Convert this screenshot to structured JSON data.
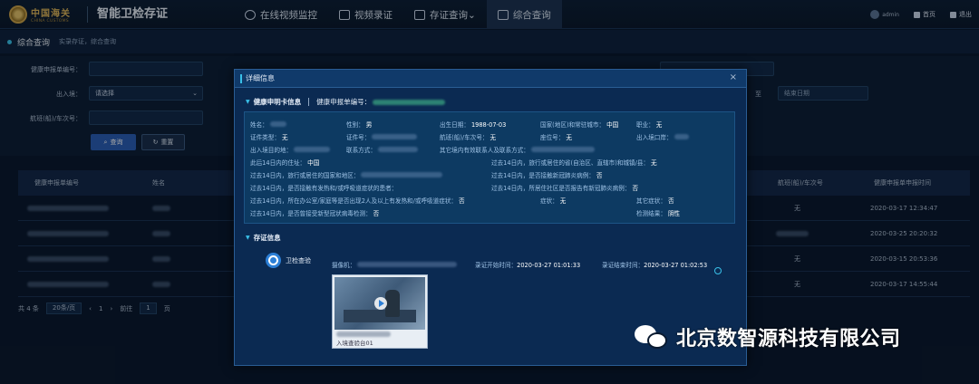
{
  "topbar": {
    "logo_cn": "中国海关",
    "logo_en": "CHINA CUSTOMS",
    "app_title": "智能卫检存证",
    "nav": [
      {
        "label": "在线视频监控",
        "icon": "monitor-icon"
      },
      {
        "label": "视频录证",
        "icon": "video-record-icon"
      },
      {
        "label": "存证查询⌄",
        "icon": "evidence-query-icon"
      },
      {
        "label": "综合查询",
        "icon": "layers-icon"
      }
    ],
    "user": "admin",
    "home": "首页",
    "logout": "退出"
  },
  "breadcrumb": {
    "title": "综合查询",
    "subtitle": "实录存证，综合查询"
  },
  "filters": {
    "label_health_no": "健康申报单编号：",
    "label_entry_exit": "出入境：",
    "entry_exit_value": "请选择",
    "label_flight": "航班(船)/车次号：",
    "label_end_date": "至",
    "end_date_placeholder": "结束日期",
    "query_button": "查询",
    "reset_button": "重置"
  },
  "table": {
    "col_health_no": "健康申报单编号",
    "col_name": "姓名",
    "col_flight": "航班(船)/车次号",
    "col_time": "健康申报单申报时间",
    "rows": [
      {
        "flight": "无",
        "time": "2020-03-17 12:34:47"
      },
      {
        "flight": "",
        "time": "2020-03-25 20:20:32"
      },
      {
        "flight": "无",
        "time": "2020-03-15 20:53:36"
      },
      {
        "flight": "无",
        "time": "2020-03-17 14:55:44"
      }
    ]
  },
  "pager": {
    "total": "共 4 条",
    "page_size": "20条/页",
    "current": "1",
    "goto_label": "前往",
    "goto_value": "1",
    "goto_unit": "页"
  },
  "modal": {
    "title": "详细信息",
    "close": "×",
    "health_section": "健康申明卡信息",
    "health_no_label": "健康申报单编号：",
    "fields": {
      "name": "姓名：",
      "gender": "性别：",
      "gender_v": "男",
      "birth": "出生日期：",
      "birth_v": "1988-07-03",
      "country": "国家(地区)和常驻城市：",
      "country_v": "中国",
      "job": "职业：",
      "job_v": "无",
      "id_type": "证件类型：",
      "id_type_v": "无",
      "id_no": "证件号：",
      "flight": "航班(船)/车次号：",
      "flight_v": "无",
      "seat": "座位号：",
      "seat_v": "无",
      "port": "出入境口岸：",
      "dest": "出入境目的地：",
      "phone": "联系方式：",
      "contact": "其它境内有效联系人及联系方式：",
      "addr14": "此后14日内的住址：",
      "addr14_v": "中国",
      "q_travel": "过去14日内，旅行或居住的国家和地区：",
      "q_hubei": "过去14日内，旅行或居住的省(自治区、直辖市)和城镇/县：",
      "q_hubei_v": "无",
      "q_contact_fever": "过去14日内，是否接触有发热和/或呼吸道症状的患者：",
      "q_contact_cov": "过去14日内，是否接触新冠肺炎病例：",
      "q_contact_cov_v": "否",
      "q_same_place": "过去14日内，所在办公室/家庭等是否出现2人及以上有发热和/或呼吸道症状：",
      "q_same_place_v": "否",
      "q_report": "过去14日内，所居住社区是否报告有新冠肺炎病例：",
      "q_report_v": "否",
      "symptom": "症状：",
      "symptom_v": "无",
      "other_symptom": "其它症状：",
      "other_symptom_v": "否",
      "q_test": "过去14日内，是否曾接受新型冠状病毒检测：",
      "q_test_v": "否",
      "test_result": "检测结果：",
      "test_result_v": "阴性"
    },
    "evidence_section": "存证信息",
    "evidence_type": "卫检查验",
    "camera_label": "摄像机：",
    "start_label": "录证开始时间：",
    "start_v": "2020-03-27 01:01:33",
    "end_label": "录证结束时间：",
    "end_v": "2020-03-27 01:02:53",
    "video_caption": "入境查验台01"
  },
  "watermark": "北京数智源科技有限公司"
}
